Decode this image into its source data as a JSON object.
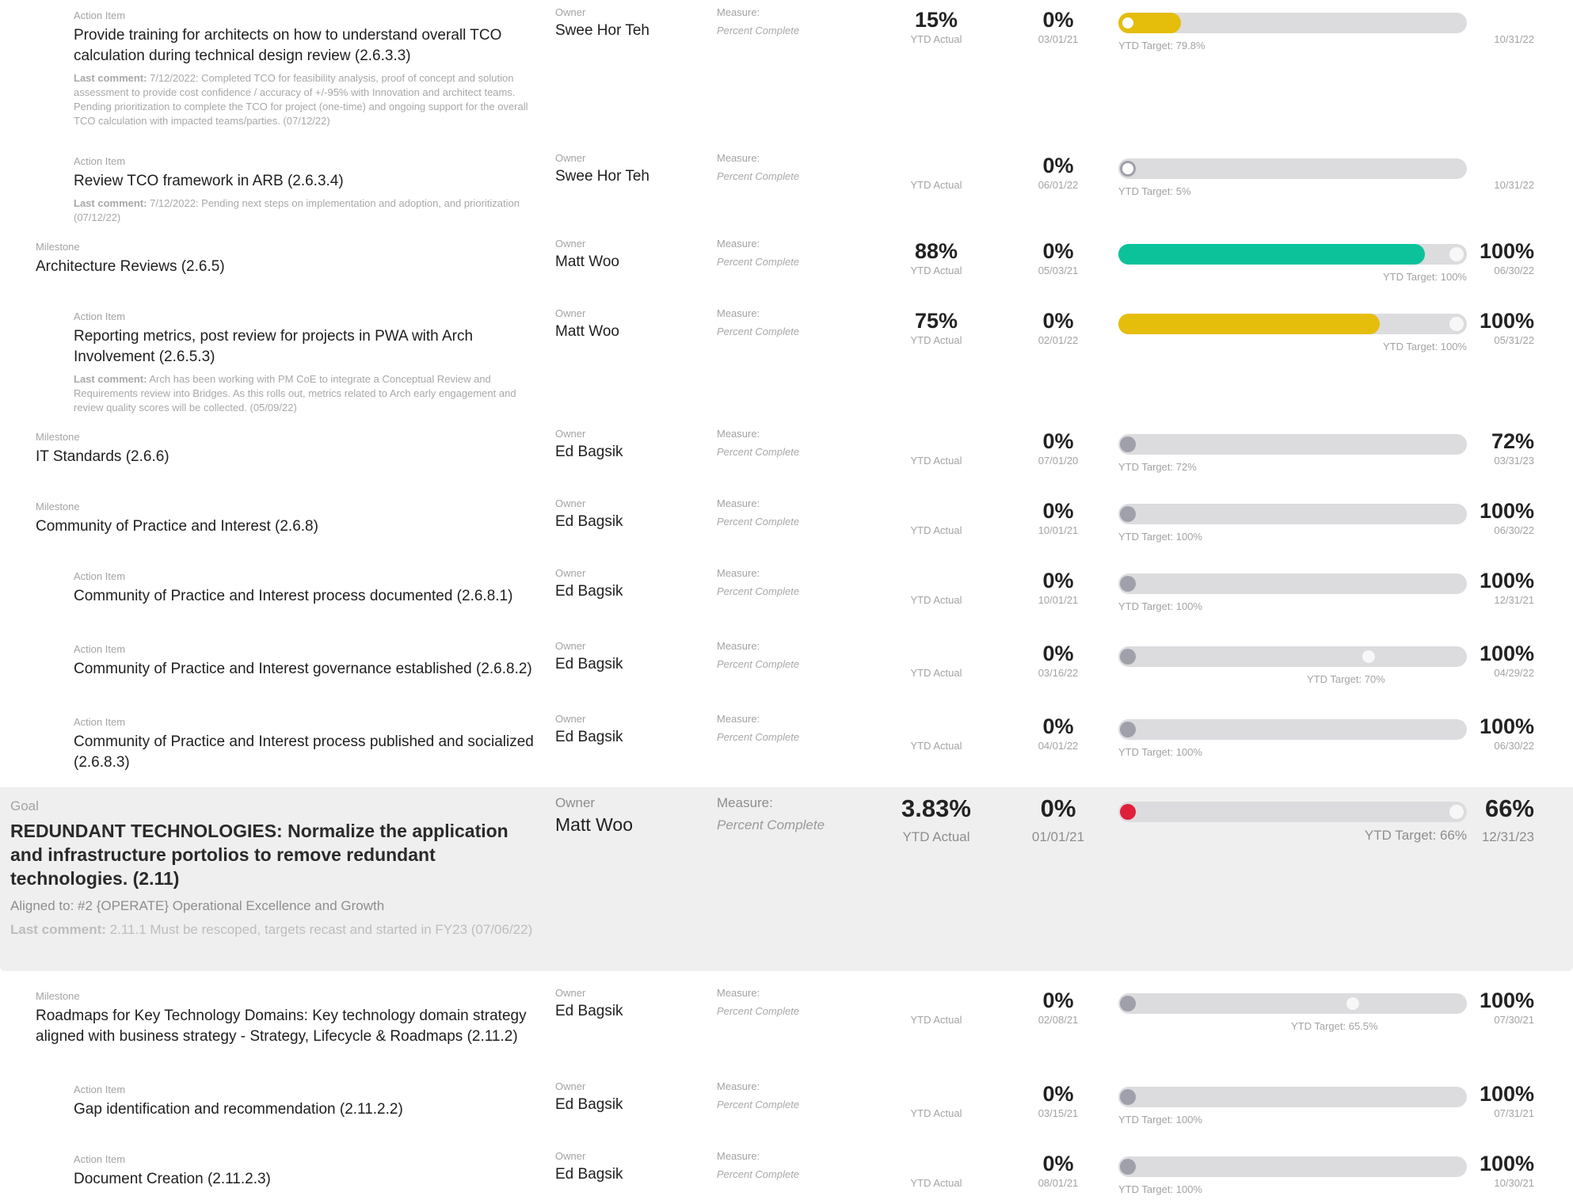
{
  "labels": {
    "owner": "Owner",
    "measure": "Measure:",
    "ytd_actual": "YTD Actual",
    "last_comment": "Last comment:"
  },
  "colors": {
    "yellow": "#e5bd0b",
    "green": "#0bc29b",
    "red": "#e0203a",
    "track": "#dcdcdf",
    "knob_grey": "#9fa0aa"
  },
  "rows": [
    {
      "kind": "Action Item",
      "title": "Provide training for architects on how to understand overall TCO calculation during technical design review (2.6.3.3)",
      "comment": "7/12/2022: Completed TCO for feasibility analysis, proof of concept and solution assessment to provide cost confidence / accuracy of +/-95% with Innovation and architect teams. Pending prioritization to complete the TCO for project (one-time) and ongoing support for the overall TCO calculation with impacted teams/parties. (07/12/22)",
      "owner": "Swee Hor Teh",
      "measure": "Percent Complete",
      "ytd_actual": "15%",
      "start_pct": "0%",
      "start_date": "03/01/21",
      "progress": 0.18,
      "fill_color": "yellow",
      "knob": "hollow-left",
      "target_label": "YTD Target: 79.8%",
      "target_pos": "left",
      "target_marker": null,
      "endcap": false,
      "end_value": "",
      "end_date": "10/31/22"
    },
    {
      "kind": "Action Item",
      "title": "Review TCO framework in ARB (2.6.3.4)",
      "comment": "7/12/2022: Pending next steps on implementation and adoption, and prioritization (07/12/22)",
      "owner": "Swee Hor Teh",
      "measure": "Percent Complete",
      "ytd_actual": "",
      "start_pct": "0%",
      "start_date": "06/01/22",
      "progress": 0,
      "fill_color": null,
      "knob": "hollow-grey",
      "target_label": "YTD Target: 5%",
      "target_pos": "left",
      "target_marker": null,
      "endcap": false,
      "end_value": "",
      "end_date": "10/31/22"
    },
    {
      "kind": "Milestone",
      "title": "Architecture Reviews (2.6.5)",
      "comment": "",
      "owner": "Matt Woo",
      "measure": "Percent Complete",
      "ytd_actual": "88%",
      "start_pct": "0%",
      "start_date": "05/03/21",
      "progress": 0.88,
      "fill_color": "green",
      "knob": "none",
      "target_label": "YTD Target: 100%",
      "target_pos": "right",
      "target_marker": null,
      "endcap": true,
      "end_value": "100%",
      "end_date": "06/30/22"
    },
    {
      "kind": "Action Item",
      "title": "Reporting metrics, post review for projects in PWA with Arch Involvement (2.6.5.3)",
      "comment": "Arch has been working with PM CoE to integrate a Conceptual Review and Requirements review into Bridges. As this rolls out, metrics related to Arch early engagement and review quality scores will be collected. (05/09/22)",
      "owner": "Matt Woo",
      "measure": "Percent Complete",
      "ytd_actual": "75%",
      "start_pct": "0%",
      "start_date": "02/01/22",
      "progress": 0.75,
      "fill_color": "yellow",
      "knob": "none",
      "target_label": "YTD Target: 100%",
      "target_pos": "right",
      "target_marker": null,
      "endcap": true,
      "end_value": "100%",
      "end_date": "05/31/22"
    },
    {
      "kind": "Milestone",
      "title": "IT Standards (2.6.6)",
      "comment": "",
      "owner": "Ed Bagsik",
      "measure": "Percent Complete",
      "ytd_actual": "",
      "start_pct": "0%",
      "start_date": "07/01/20",
      "progress": 0,
      "fill_color": null,
      "knob": "grey",
      "target_label": "YTD Target: 72%",
      "target_pos": "left",
      "target_marker": null,
      "endcap": false,
      "end_value": "72%",
      "end_date": "03/31/23"
    },
    {
      "kind": "Milestone",
      "title": "Community of Practice and Interest (2.6.8)",
      "comment": "",
      "owner": "Ed Bagsik",
      "measure": "Percent Complete",
      "ytd_actual": "",
      "start_pct": "0%",
      "start_date": "10/01/21",
      "progress": 0,
      "fill_color": null,
      "knob": "grey",
      "target_label": "YTD Target: 100%",
      "target_pos": "left",
      "target_marker": null,
      "endcap": false,
      "end_value": "100%",
      "end_date": "06/30/22"
    },
    {
      "kind": "Action Item",
      "title": "Community of Practice and Interest process documented (2.6.8.1)",
      "comment": "",
      "owner": "Ed Bagsik",
      "measure": "Percent Complete",
      "ytd_actual": "",
      "start_pct": "0%",
      "start_date": "10/01/21",
      "progress": 0,
      "fill_color": null,
      "knob": "grey",
      "target_label": "YTD Target: 100%",
      "target_pos": "left",
      "target_marker": null,
      "endcap": false,
      "end_value": "100%",
      "end_date": "12/31/21"
    },
    {
      "kind": "Action Item",
      "title": "Community of Practice and Interest governance established (2.6.8.2)",
      "comment": "",
      "owner": "Ed Bagsik",
      "measure": "Percent Complete",
      "ytd_actual": "",
      "start_pct": "0%",
      "start_date": "03/16/22",
      "progress": 0,
      "fill_color": null,
      "knob": "grey",
      "target_label": "YTD Target: 70%",
      "target_pos": "marker",
      "target_marker": 0.7,
      "endcap": false,
      "end_value": "100%",
      "end_date": "04/29/22"
    },
    {
      "kind": "Action Item",
      "title": "Community of Practice and Interest process published and socialized (2.6.8.3)",
      "comment": "",
      "owner": "Ed Bagsik",
      "measure": "Percent Complete",
      "ytd_actual": "",
      "start_pct": "0%",
      "start_date": "04/01/22",
      "progress": 0,
      "fill_color": null,
      "knob": "grey",
      "target_label": "YTD Target: 100%",
      "target_pos": "left",
      "target_marker": null,
      "endcap": false,
      "end_value": "100%",
      "end_date": "06/30/22"
    },
    {
      "kind": "Goal",
      "title": "REDUNDANT TECHNOLOGIES: Normalize the application and infrastructure portolios to remove redundant technologies. (2.11)",
      "aligned": "Aligned to: #2 {OPERATE} Operational Excellence and Growth",
      "comment": "2.11.1 Must be rescoped, targets recast and started in FY23 (07/06/22)",
      "owner": "Matt Woo",
      "measure": "Percent Complete",
      "ytd_actual": "3.83%",
      "start_pct": "0%",
      "start_date": "01/01/21",
      "progress": 0,
      "fill_color": null,
      "knob": "red",
      "target_label": "YTD Target: 66%",
      "target_pos": "right",
      "target_marker": null,
      "endcap": true,
      "end_value": "66%",
      "end_date": "12/31/23"
    },
    {
      "kind": "Milestone",
      "title": "Roadmaps for Key Technology Domains: Key technology domain strategy aligned with business strategy - Strategy, Lifecycle & Roadmaps (2.11.2)",
      "comment": "",
      "owner": "Ed Bagsik",
      "measure": "Percent Complete",
      "ytd_actual": "",
      "start_pct": "0%",
      "start_date": "02/08/21",
      "progress": 0,
      "fill_color": null,
      "knob": "grey",
      "target_label": "YTD Target: 65.5%",
      "target_pos": "marker",
      "target_marker": 0.655,
      "endcap": false,
      "end_value": "100%",
      "end_date": "07/30/21"
    },
    {
      "kind": "Action Item",
      "title": "Gap identification and recommendation (2.11.2.2)",
      "comment": "",
      "owner": "Ed Bagsik",
      "measure": "Percent Complete",
      "ytd_actual": "",
      "start_pct": "0%",
      "start_date": "03/15/21",
      "progress": 0,
      "fill_color": null,
      "knob": "grey",
      "target_label": "YTD Target: 100%",
      "target_pos": "left",
      "target_marker": null,
      "endcap": false,
      "end_value": "100%",
      "end_date": "07/31/21"
    },
    {
      "kind": "Action Item",
      "title": "Document Creation (2.11.2.3)",
      "comment": "",
      "owner": "Ed Bagsik",
      "measure": "Percent Complete",
      "ytd_actual": "",
      "start_pct": "0%",
      "start_date": "08/01/21",
      "progress": 0,
      "fill_color": null,
      "knob": "grey",
      "target_label": "YTD Target: 100%",
      "target_pos": "left",
      "target_marker": null,
      "endcap": false,
      "end_value": "100%",
      "end_date": "10/30/21"
    }
  ]
}
